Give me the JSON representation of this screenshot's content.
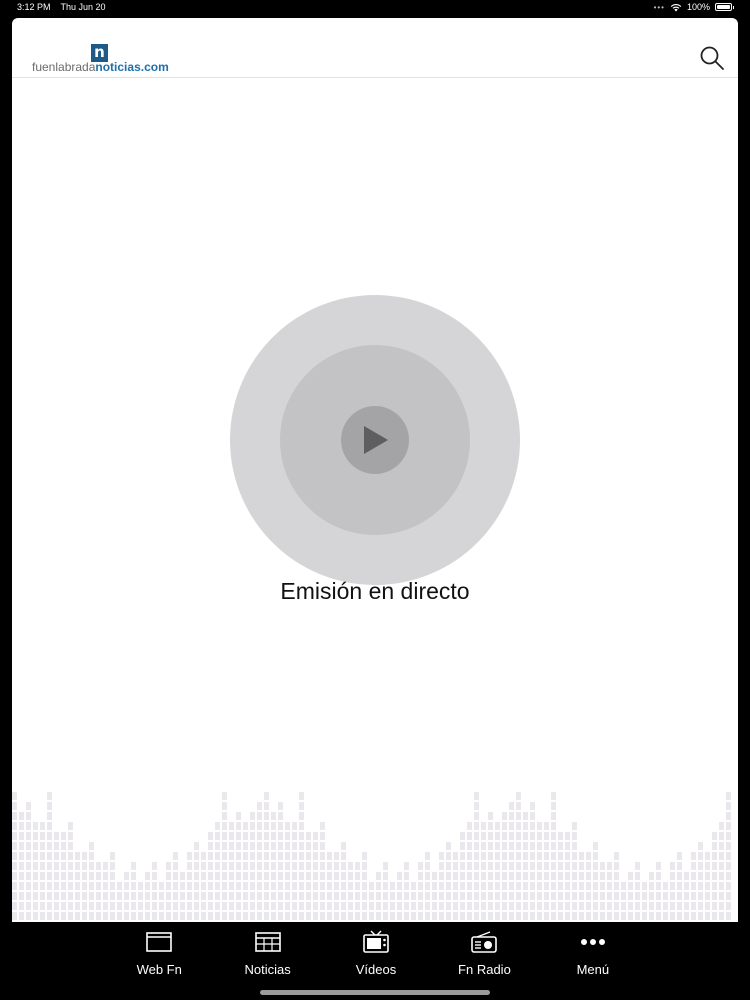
{
  "status_bar": {
    "time": "3:12 PM",
    "date": "Thu Jun 20",
    "battery": "100%"
  },
  "header": {
    "logo": {
      "mark": "n",
      "text_part1": "fuenlabrada",
      "text_part2": "noticias.com"
    },
    "search_icon": "search-icon"
  },
  "player": {
    "play_icon": "play-icon",
    "live_label": "Emisión en directo"
  },
  "tabs": [
    {
      "label": "Web Fn",
      "icon": "browser-window-icon"
    },
    {
      "label": "Noticias",
      "icon": "newspaper-icon"
    },
    {
      "label": "Vídeos",
      "icon": "tv-icon"
    },
    {
      "label": "Fn Radio",
      "icon": "radio-icon"
    },
    {
      "label": "Menú",
      "icon": "more-dots-icon"
    }
  ],
  "colors": {
    "accent": "#1f6fa8",
    "logo_mark": "#1d5a87",
    "background": "#ffffff",
    "tab_bar": "#000000"
  }
}
